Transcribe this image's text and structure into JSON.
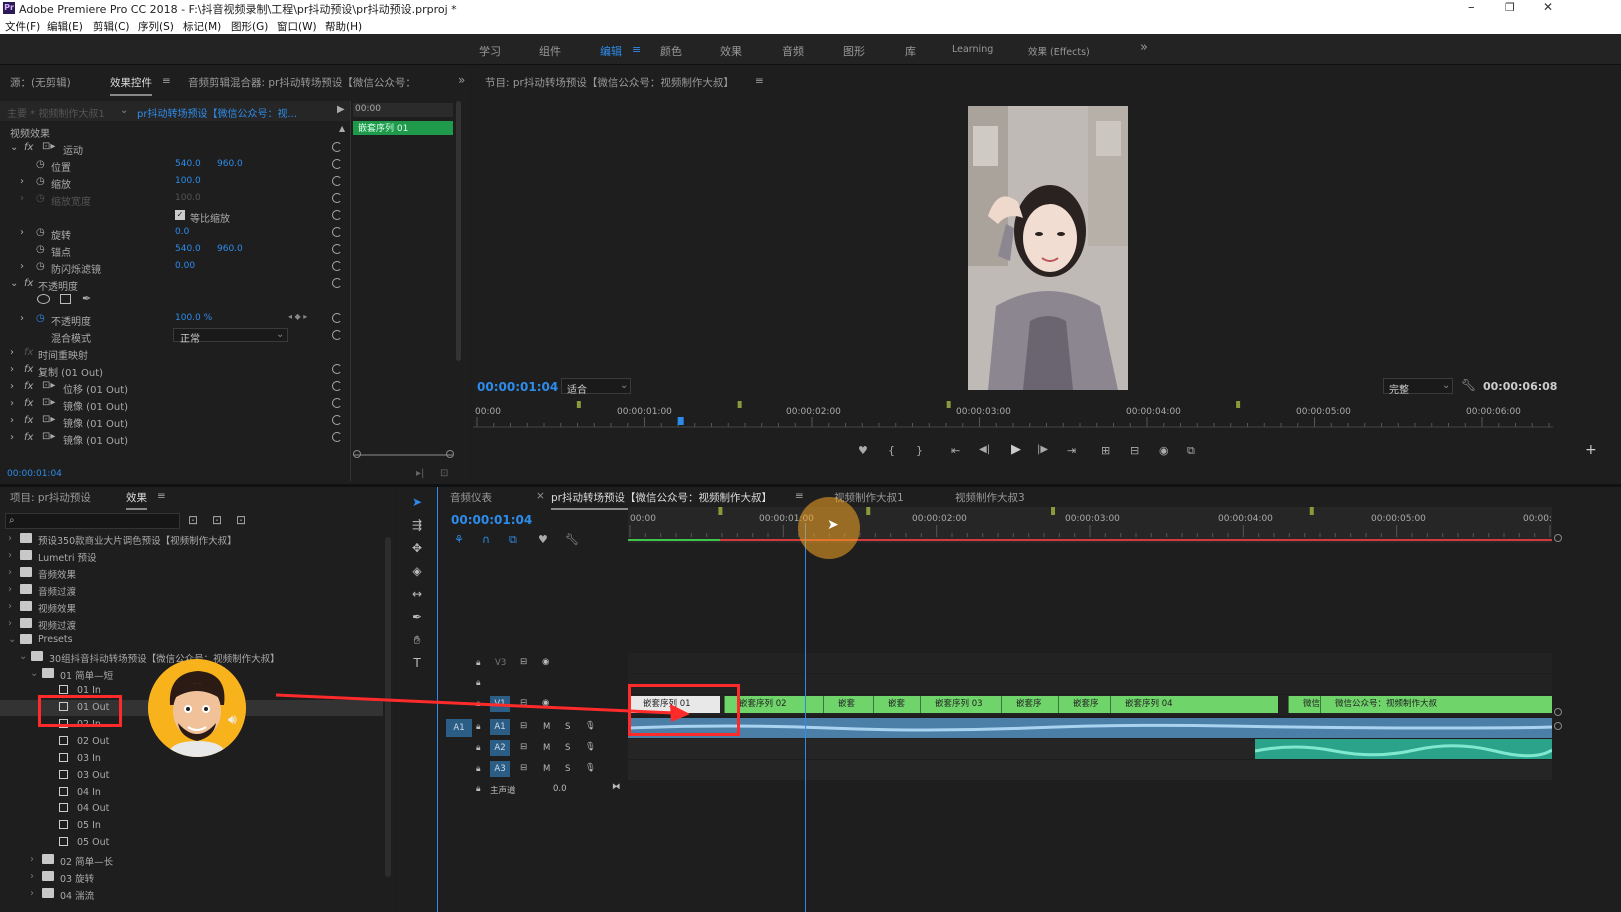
{
  "window": {
    "title": "Adobe Premiere Pro CC 2018 - F:\\抖音视频录制\\工程\\pr抖动预设\\pr抖动预设.prproj *",
    "min": "–",
    "max": "❐",
    "close": "✕"
  },
  "menu": [
    "文件(F)",
    "编辑(E)",
    "剪辑(C)",
    "序列(S)",
    "标记(M)",
    "图形(G)",
    "窗口(W)",
    "帮助(H)"
  ],
  "workspaces": [
    "学习",
    "组件",
    "编辑",
    "颜色",
    "效果",
    "音频",
    "图形",
    "库",
    "Learning",
    "效果 (Effects)"
  ],
  "workspace_menu": "≡",
  "workspace_more": "»",
  "effect_controls": {
    "tabs": [
      "源：(无剪辑)",
      "效果控件",
      "音频剪辑混合器: pr抖动转场预设【微信公众号：",
      "»"
    ],
    "tab_menu": "≡",
    "master": "主要 * 视频制作大叔1",
    "clip_name": "pr抖动转场预设【微信公众号：视...",
    "timecode_head": "00:00",
    "nested_clip": "嵌套序列 01",
    "section": "视频效果",
    "motion": "运动",
    "position": {
      "label": "位置",
      "x": "540.0",
      "y": "960.0"
    },
    "scale": {
      "label": "缩放",
      "value": "100.0"
    },
    "scale_width": {
      "label": "缩放宽度",
      "value": "100.0"
    },
    "uniform": "等比缩放",
    "rotation": {
      "label": "旋转",
      "value": "0.0"
    },
    "anchor": {
      "label": "锚点",
      "x": "540.0",
      "y": "960.0"
    },
    "antiflicker": {
      "label": "防闪烁滤镜",
      "value": "0.00"
    },
    "opacity_group": "不透明度",
    "opacity": {
      "label": "不透明度",
      "value": "100.0 %"
    },
    "blend": {
      "label": "混合模式",
      "value": "正常"
    },
    "time_remap": "时间重映射",
    "fx_list": [
      "复制 (01 Out)",
      "位移 (01 Out)",
      "镜像 (01 Out)",
      "镜像 (01 Out)",
      "镜像 (01 Out)"
    ],
    "timecode": "00:00:01:04"
  },
  "program": {
    "title": "节目: pr抖动转场预设【微信公众号：视频制作大叔】",
    "menu": "≡",
    "timecode": "00:00:01:04",
    "fit": "适合",
    "quality": "完整",
    "duration": "00:00:06:08",
    "ruler": [
      "00:00",
      "00:00:01:00",
      "00:00:02:00",
      "00:00:03:00",
      "00:00:04:00",
      "00:00:05:00",
      "00:00:06:00"
    ],
    "playhead_progress": 0.19,
    "transport": [
      "♥",
      "{",
      "}",
      "⇤",
      "◀|",
      "▶",
      "|▶",
      "⇥",
      "⊞",
      "⊟",
      "◉",
      "⧉",
      "+"
    ]
  },
  "project": {
    "tabs": [
      "项目: pr抖动预设",
      "效果"
    ],
    "tab_menu": "≡",
    "search_placeholder": "",
    "tree": [
      "预设350款商业大片调色预设【视频制作大叔】",
      "Lumetri 预设",
      "音频效果",
      "音频过渡",
      "视频效果",
      "视频过渡",
      "Presets",
      "30组抖音抖动转场预设【微信公众号：视频制作大叔】",
      "01 简单—短",
      "01 In",
      "01 Out",
      "02 In",
      "02 Out",
      "03 In",
      "03 Out",
      "04 In",
      "04 Out",
      "05 In",
      "05 Out",
      "02 简单—长",
      "03 旋转",
      "04 湍流"
    ]
  },
  "timeline": {
    "tabs": [
      "音频仪表",
      "pr抖动转场预设【微信公众号：视频制作大叔】",
      "视频制作大叔1",
      "视频制作大叔3"
    ],
    "tab_close": "×",
    "tab_menu": "≡",
    "timecode": "00:00:01:04",
    "ruler": [
      "00:00",
      "00:00:01:00",
      "00:00:02:00",
      "00:00:03:00",
      "00:00:04:00",
      "00:00:05:00",
      "00:00:"
    ],
    "tracks": {
      "v3": "V3",
      "v1": "V1",
      "a1": "A1",
      "a2": "A2",
      "a3": "A3",
      "src_a1": "A1",
      "m": "M",
      "s": "S",
      "master": "主声道",
      "master_value": "0.0"
    },
    "clips": [
      "嵌套序列 01",
      "嵌套序列 02",
      "嵌套",
      "嵌套",
      "嵌套序列 03",
      "嵌套序",
      "嵌套序",
      "嵌套序列 04",
      "微信公众号",
      "微信公众号：视频制作大叔"
    ],
    "playhead_progress": 0.192
  },
  "colors": {
    "accent": "#2d8ceb",
    "clip": "#6fd46a",
    "audio": "#4b7fa8",
    "annotation": "#ff2a2a"
  }
}
